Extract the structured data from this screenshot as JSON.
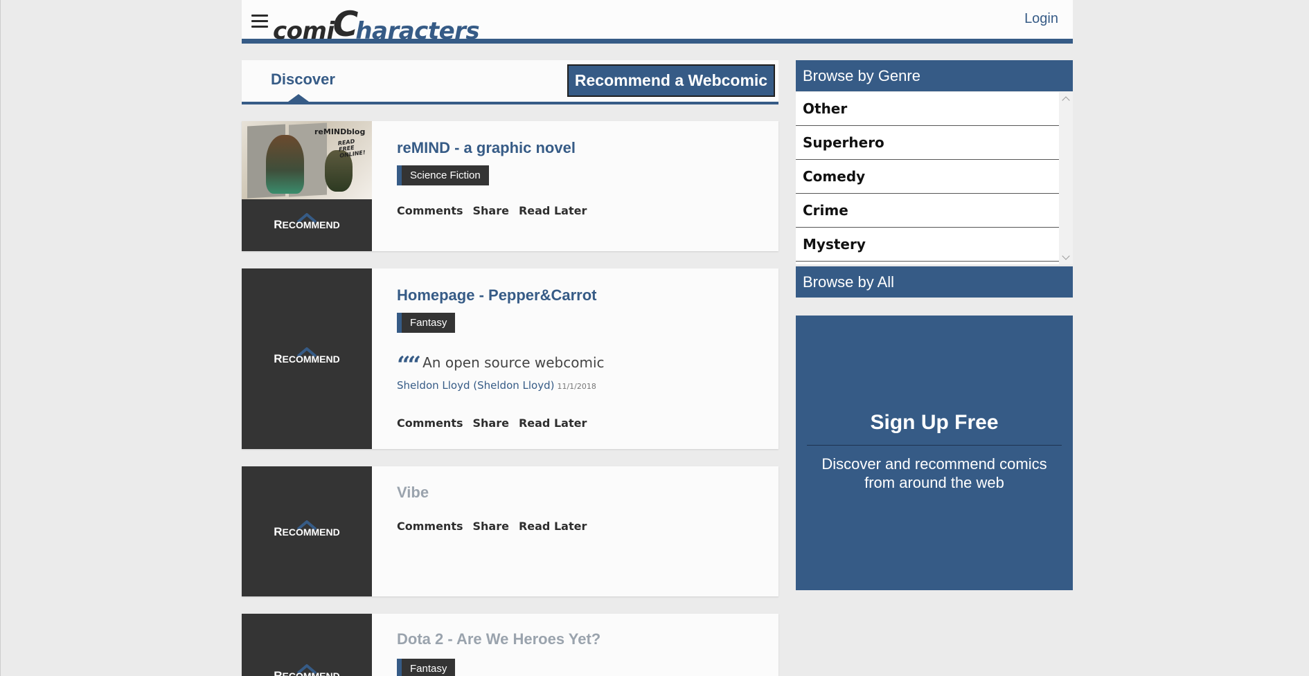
{
  "header": {
    "logo_part1": "comi",
    "logo_part2": "C",
    "logo_part3": "haracters",
    "login_label": "Login"
  },
  "discover": {
    "tab_label": "Discover",
    "recommend_button": "Recommend a Webcomic"
  },
  "recommend_label": {
    "first": "R",
    "rest": "ECOMMEND"
  },
  "actions": {
    "comments": "Comments",
    "share": "Share",
    "read_later": "Read Later"
  },
  "cards": [
    {
      "title": "reMIND - a graphic novel",
      "tag": "Science Fiction",
      "thumb_text1": "reMINDblog",
      "thumb_text2": "READ FREE ONLINE!"
    },
    {
      "title": "Homepage - Pepper&Carrot",
      "tag": "Fantasy",
      "quote": "An open source webcomic",
      "author": "Sheldon Lloyd (Sheldon Lloyd)",
      "date": "11/1/2018"
    },
    {
      "title": "Vibe"
    },
    {
      "title": "Dota 2 - Are We Heroes Yet?",
      "tag": "Fantasy"
    }
  ],
  "sidebar": {
    "genre_heading": "Browse by Genre",
    "genres": [
      "Other",
      "Superhero",
      "Comedy",
      "Crime",
      "Mystery"
    ],
    "all_heading": "Browse by All",
    "signup_title": "Sign Up Free",
    "signup_desc": "Discover and recommend comics from around the web"
  },
  "colors": {
    "accent": "#365b86",
    "dark": "#343434",
    "background": "#ebebeb"
  }
}
